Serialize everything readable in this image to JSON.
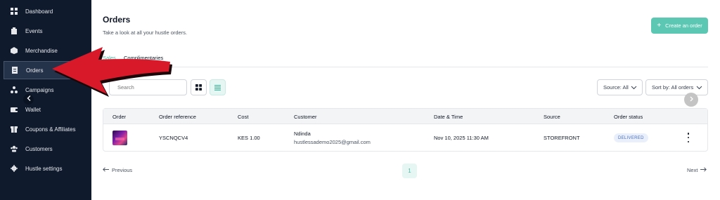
{
  "sidebar": {
    "items": [
      {
        "label": "Dashboard",
        "icon": "dashboard-icon"
      },
      {
        "label": "Events",
        "icon": "events-icon"
      },
      {
        "label": "Merchandise",
        "icon": "merchandise-icon"
      },
      {
        "label": "Orders",
        "icon": "orders-icon",
        "active": true
      },
      {
        "label": "Campaigns",
        "icon": "campaigns-icon"
      },
      {
        "label": "Wallet",
        "icon": "wallet-icon"
      },
      {
        "label": "Coupons & Affiliates",
        "icon": "coupons-icon"
      },
      {
        "label": "Customers",
        "icon": "customers-icon"
      },
      {
        "label": "Hustle settings",
        "icon": "settings-icon"
      }
    ],
    "collapse_icon": "chevron-left-icon"
  },
  "header": {
    "title": "Orders",
    "subtitle": "Take a look at all your hustle orders.",
    "create_button": "Create an order"
  },
  "tabs": [
    {
      "label": "Sales",
      "active": true
    },
    {
      "label": "Complimentaries",
      "active": false
    }
  ],
  "toolbar": {
    "search_placeholder": "Search",
    "source_filter": "Source: All",
    "sort_filter": "Sort by: All orders"
  },
  "table": {
    "columns": [
      "Order",
      "Order reference",
      "Cost",
      "Customer",
      "Date & Time",
      "Source",
      "Order status"
    ],
    "rows": [
      {
        "reference": "YSCNQCV4",
        "cost": "KES 1.00",
        "customer_name": "Ndinda",
        "customer_email": "hustlessademo2025@gmail.com",
        "datetime": "Nov 10, 2025 11:30 AM",
        "source": "STOREFRONT",
        "status": "DELIVERED"
      }
    ]
  },
  "pagination": {
    "previous": "Previous",
    "next": "Next",
    "current_page": "1"
  },
  "colors": {
    "sidebar_bg": "#0f1b2d",
    "accent": "#5cc8b3",
    "annotation_arrow": "#d8192a"
  }
}
